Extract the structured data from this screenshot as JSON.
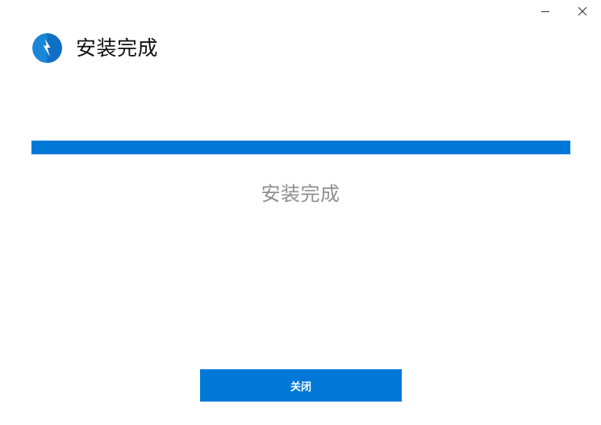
{
  "window": {
    "minimize_icon": "minimize-icon",
    "close_icon": "close-icon"
  },
  "header": {
    "logo_icon": "lightning-bolt-icon",
    "title": "安装完成"
  },
  "progress": {
    "percent": 100
  },
  "status": {
    "text": "安装完成"
  },
  "actions": {
    "close_label": "关闭"
  },
  "colors": {
    "accent": "#0078d7",
    "status_text": "#8f8f8f",
    "title_text": "#111111"
  }
}
